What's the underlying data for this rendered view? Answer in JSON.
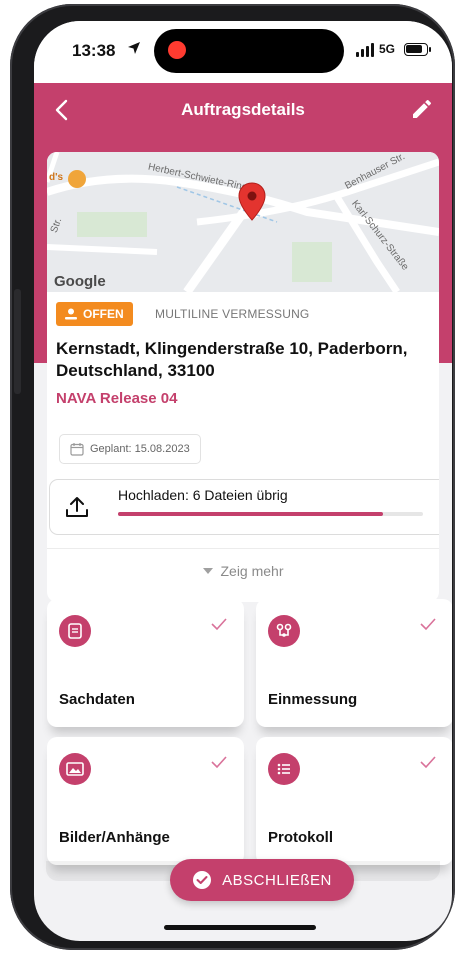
{
  "status_bar": {
    "time": "13:38",
    "network": "5G"
  },
  "header": {
    "title": "Auftragsdetails"
  },
  "map": {
    "attribution": "Google",
    "street_labels": [
      "Herbert-Schwiete-Ring",
      "Benhauser Str.",
      "Karl-Schurz-Straße",
      "d's",
      "Str."
    ]
  },
  "order": {
    "status": "OFFEN",
    "type": "MULTILINE VERMESSUNG",
    "address": "Kernstadt, Klingenderstraße 10, Paderborn, Deutschland, 33100",
    "release": "NAVA Release 04",
    "planned": "Geplant: 15.08.2023"
  },
  "upload": {
    "label": "Hochladen: 6 Dateien übrig",
    "progress": 0.87
  },
  "show_more": {
    "label": "Zeig mehr"
  },
  "tiles": [
    {
      "label": "Sachdaten",
      "icon": "document-icon",
      "done": true
    },
    {
      "label": "Einmessung",
      "icon": "measure-icon",
      "done": true
    },
    {
      "label": "Bilder/Anhänge",
      "icon": "image-icon",
      "done": true
    },
    {
      "label": "Protokoll",
      "icon": "list-icon",
      "done": true
    }
  ],
  "actions": {
    "finish": "ABSCHLIEßEN"
  },
  "colors": {
    "accent": "#c4406c",
    "badge": "#f38b1f"
  }
}
